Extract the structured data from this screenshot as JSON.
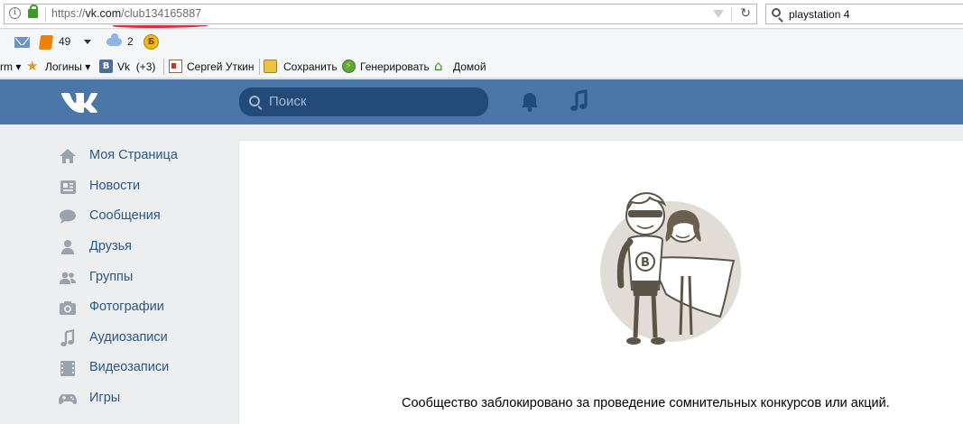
{
  "browser": {
    "url_scheme": "https://",
    "url_host": "vk.com",
    "url_path": "/club134165887",
    "search_query": "playstation 4"
  },
  "addons": {
    "ok_count": "49",
    "cloud_count": "2"
  },
  "bookmarks": [
    {
      "label": "rm",
      "has_menu": true
    },
    {
      "label": "Логины",
      "has_menu": true
    },
    {
      "label": "Vk",
      "badge": "(+3)"
    },
    {
      "label": "Сергей Уткин"
    },
    {
      "label": "Сохранить"
    },
    {
      "label": "Генерировать"
    },
    {
      "label": "Домой"
    }
  ],
  "vk_header": {
    "search_placeholder": "Поиск"
  },
  "sidebar": {
    "items": [
      {
        "label": "Моя Страница",
        "icon": "home-icon"
      },
      {
        "label": "Новости",
        "icon": "news-icon"
      },
      {
        "label": "Сообщения",
        "icon": "messages-icon"
      },
      {
        "label": "Друзья",
        "icon": "friends-icon"
      },
      {
        "label": "Группы",
        "icon": "groups-icon"
      },
      {
        "label": "Фотографии",
        "icon": "camera-icon"
      },
      {
        "label": "Аудиозаписи",
        "icon": "music-icon"
      },
      {
        "label": "Видеозаписи",
        "icon": "video-icon"
      },
      {
        "label": "Игры",
        "icon": "gamepad-icon"
      }
    ]
  },
  "main": {
    "blocked_message": "Сообщество заблокировано за проведение сомнительных конкурсов или акций."
  },
  "colors": {
    "vk_header": "#4a76a8",
    "vk_link": "#2a5885",
    "sidebar_icon": "#99a2ad",
    "page_bg": "#edeef0"
  }
}
